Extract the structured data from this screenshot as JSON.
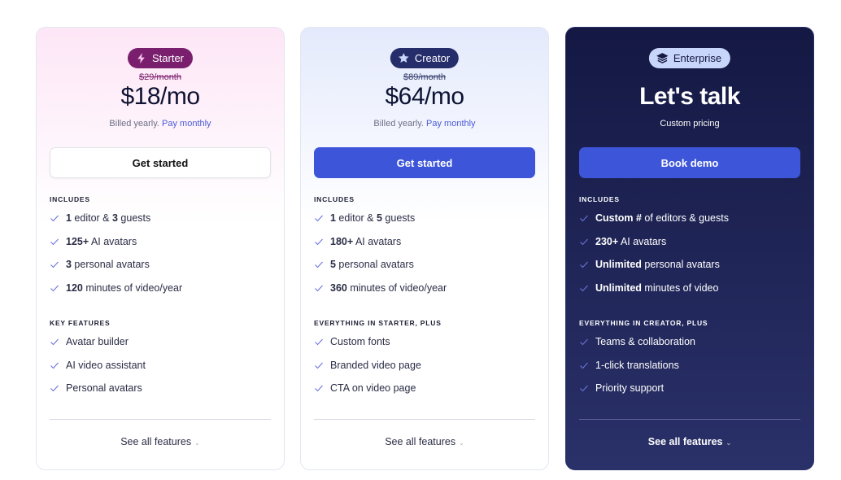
{
  "colors": {
    "accent": "#3d55d9",
    "starter_badge": "#7a1f6e",
    "creator_badge": "#262d6b",
    "enterprise_bg": "#141843"
  },
  "plans": [
    {
      "name": "Starter",
      "icon": "lightning-icon",
      "old_price": "$29/month",
      "price": "$18/mo",
      "billed": "Billed yearly.",
      "billed_link": "Pay monthly",
      "button": "Get started",
      "sections": [
        {
          "title": "INCLUDES",
          "items": [
            [
              {
                "t": "1",
                "b": true
              },
              {
                "t": " editor & "
              },
              {
                "t": "3",
                "b": true
              },
              {
                "t": " guests"
              }
            ],
            [
              {
                "t": "125+",
                "b": true
              },
              {
                "t": " AI avatars"
              }
            ],
            [
              {
                "t": "3",
                "b": true
              },
              {
                "t": " personal avatars"
              }
            ],
            [
              {
                "t": "120",
                "b": true
              },
              {
                "t": " minutes of video/year"
              }
            ]
          ]
        },
        {
          "title": "KEY FEATURES",
          "items": [
            [
              {
                "t": "Avatar builder"
              }
            ],
            [
              {
                "t": "AI video assistant"
              }
            ],
            [
              {
                "t": "Personal avatars"
              }
            ]
          ]
        }
      ],
      "see_all": "See all features"
    },
    {
      "name": "Creator",
      "icon": "star-icon",
      "old_price": "$89/month",
      "price": "$64/mo",
      "billed": "Billed yearly.",
      "billed_link": "Pay monthly",
      "button": "Get started",
      "sections": [
        {
          "title": "INCLUDES",
          "items": [
            [
              {
                "t": "1",
                "b": true
              },
              {
                "t": " editor & "
              },
              {
                "t": "5",
                "b": true
              },
              {
                "t": " guests"
              }
            ],
            [
              {
                "t": "180+",
                "b": true
              },
              {
                "t": " AI avatars"
              }
            ],
            [
              {
                "t": "5",
                "b": true
              },
              {
                "t": " personal avatars"
              }
            ],
            [
              {
                "t": "360",
                "b": true
              },
              {
                "t": " minutes of video/year"
              }
            ]
          ]
        },
        {
          "title": "EVERYTHING IN STARTER, PLUS",
          "items": [
            [
              {
                "t": "Custom fonts"
              }
            ],
            [
              {
                "t": "Branded video page"
              }
            ],
            [
              {
                "t": "CTA on video page"
              }
            ]
          ]
        }
      ],
      "see_all": "See all features"
    },
    {
      "name": "Enterprise",
      "icon": "layers-icon",
      "price": "Let's talk",
      "billed": "Custom pricing",
      "button": "Book demo",
      "sections": [
        {
          "title": "INCLUDES",
          "items": [
            [
              {
                "t": "Custom #",
                "b": true
              },
              {
                "t": " of editors & guests"
              }
            ],
            [
              {
                "t": "230+",
                "b": true
              },
              {
                "t": " AI avatars"
              }
            ],
            [
              {
                "t": "Unlimited",
                "b": true
              },
              {
                "t": " personal avatars"
              }
            ],
            [
              {
                "t": "Unlimited",
                "b": true
              },
              {
                "t": " minutes of video"
              }
            ]
          ]
        },
        {
          "title": "EVERYTHING IN CREATOR, PLUS",
          "items": [
            [
              {
                "t": "Teams & collaboration"
              }
            ],
            [
              {
                "t": "1-click translations"
              }
            ],
            [
              {
                "t": "Priority support"
              }
            ]
          ]
        }
      ],
      "see_all": "See all features"
    }
  ]
}
